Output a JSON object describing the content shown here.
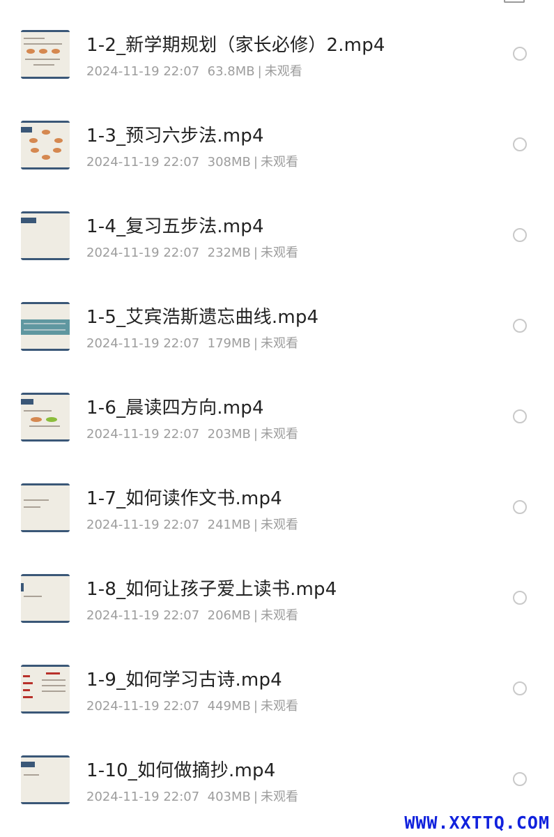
{
  "files": [
    {
      "name": "1-2_新学期规划（家长必修）2.mp4",
      "date": "2024-11-19 22:07",
      "size": "63.8MB",
      "status": "未观看"
    },
    {
      "name": "1-3_预习六步法.mp4",
      "date": "2024-11-19 22:07",
      "size": "308MB",
      "status": "未观看"
    },
    {
      "name": "1-4_复习五步法.mp4",
      "date": "2024-11-19 22:07",
      "size": "232MB",
      "status": "未观看"
    },
    {
      "name": "1-5_艾宾浩斯遗忘曲线.mp4",
      "date": "2024-11-19 22:07",
      "size": "179MB",
      "status": "未观看"
    },
    {
      "name": "1-6_晨读四方向.mp4",
      "date": "2024-11-19 22:07",
      "size": "203MB",
      "status": "未观看"
    },
    {
      "name": "1-7_如何读作文书.mp4",
      "date": "2024-11-19 22:07",
      "size": "241MB",
      "status": "未观看"
    },
    {
      "name": "1-8_如何让孩子爱上读书.mp4",
      "date": "2024-11-19 22:07",
      "size": "206MB",
      "status": "未观看"
    },
    {
      "name": "1-9_如何学习古诗.mp4",
      "date": "2024-11-19 22:07",
      "size": "449MB",
      "status": "未观看"
    },
    {
      "name": "1-10_如何做摘抄.mp4",
      "date": "2024-11-19 22:07",
      "size": "403MB",
      "status": "未观看"
    }
  ],
  "separator": "|",
  "watermark": "WWW.XXTTQ.COM",
  "colors": {
    "title": "#222222",
    "meta": "#9d9d9d",
    "thumb_border": "#3a5777",
    "thumb_bg": "#efece3",
    "watermark": "#1122dd"
  },
  "icons": {
    "top_right": "grid-view-icon",
    "thumbnail": "video-thumbnail",
    "selector": "radio-circle-icon"
  }
}
